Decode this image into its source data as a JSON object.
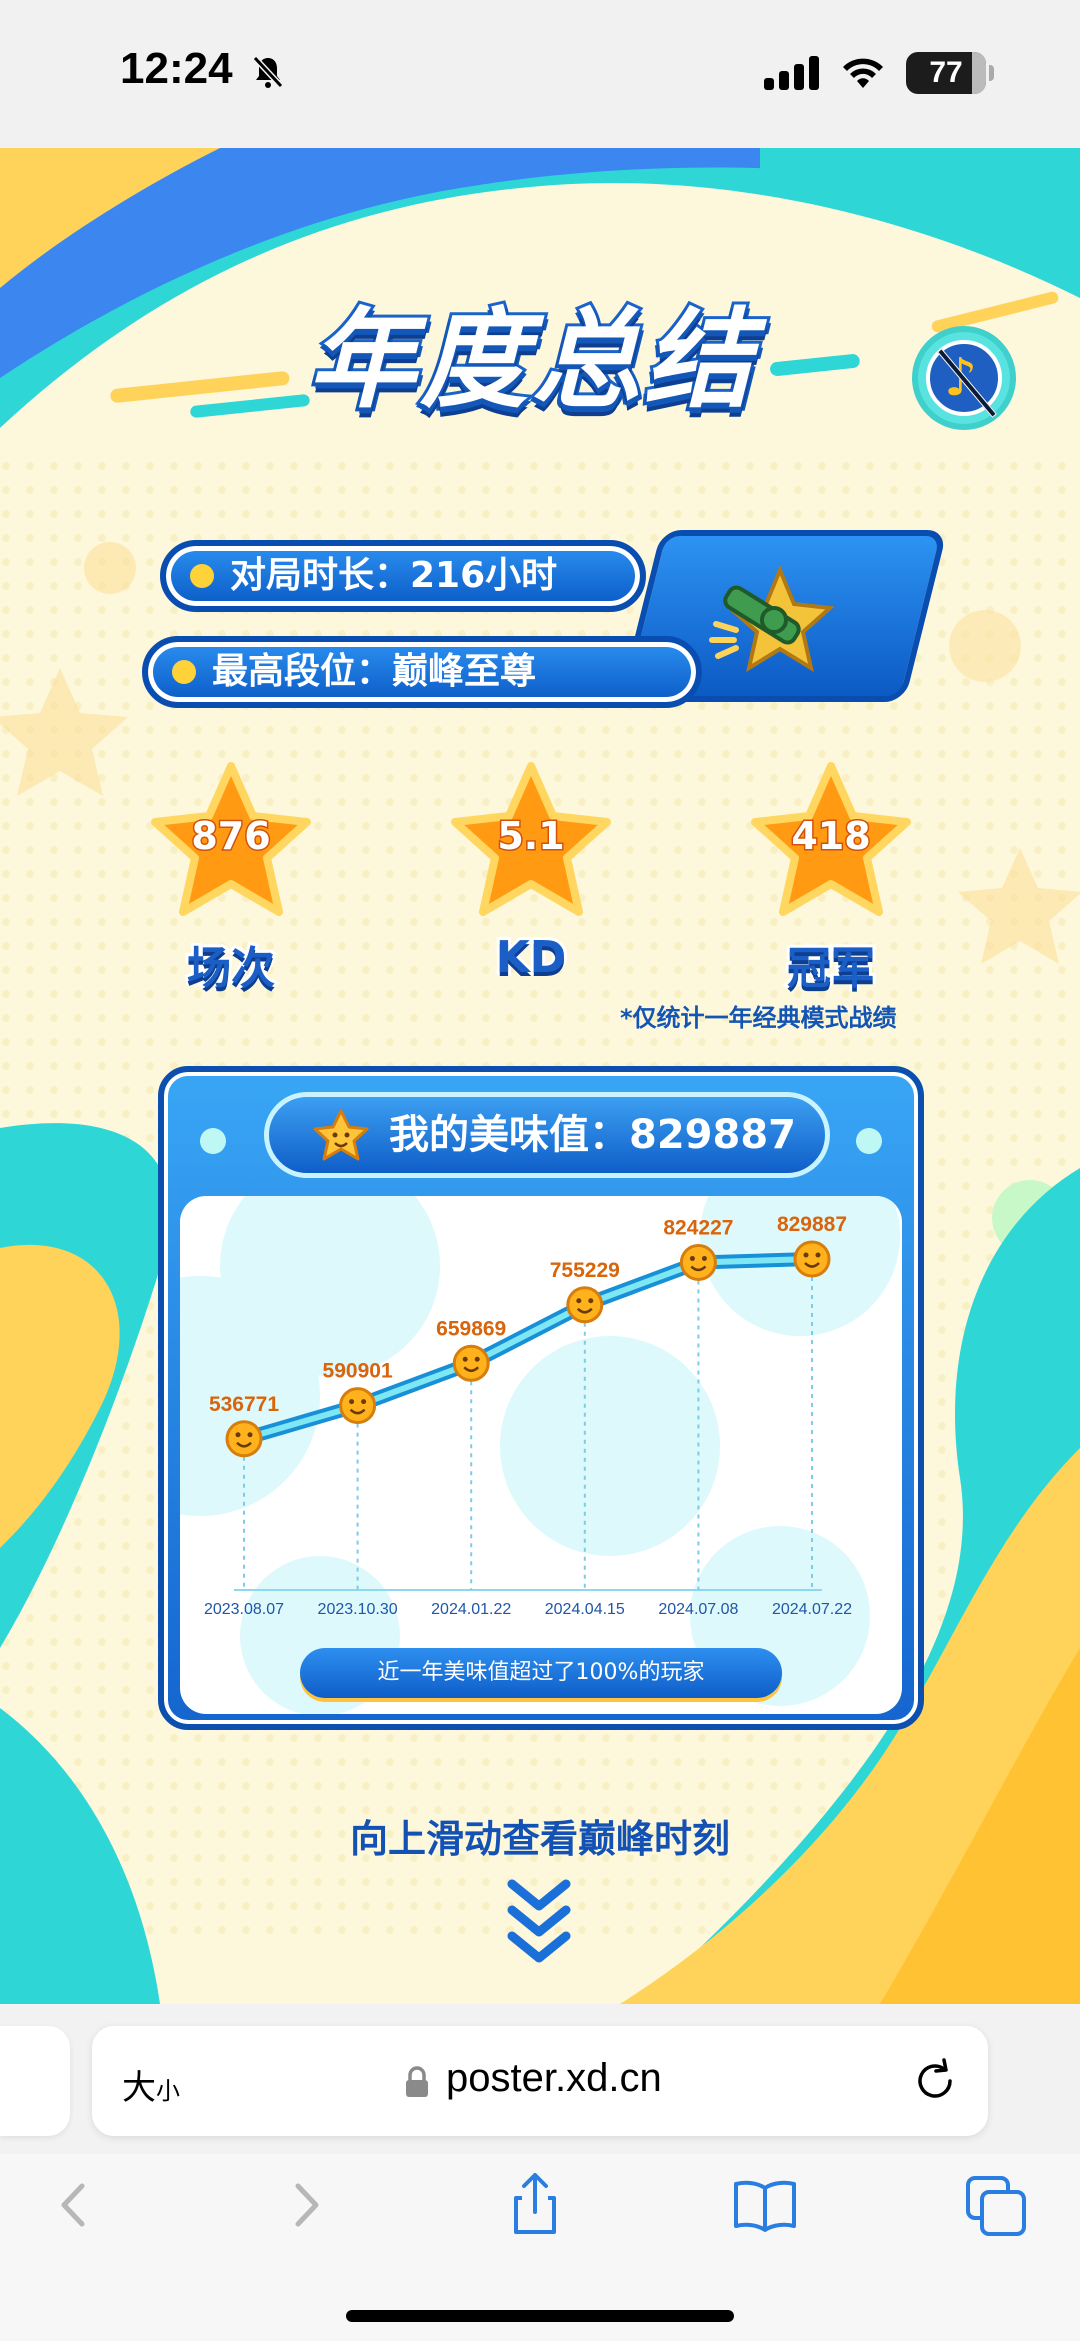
{
  "status_bar": {
    "time": "12:24",
    "battery": "77"
  },
  "poster": {
    "title": "年度总结",
    "stats": [
      {
        "label_value": "对局时长：216小时"
      },
      {
        "label_value": "最高段位：巅峰至尊"
      }
    ],
    "star_stats": [
      {
        "value": "876",
        "label": "场次"
      },
      {
        "value": "5.1",
        "label": "KD"
      },
      {
        "value": "418",
        "label": "冠军"
      }
    ],
    "footnote": "*仅统计一年经典模式战绩",
    "card": {
      "heading": "我的美味值：829887",
      "rank_text": "近一年美味值超过了100%的玩家"
    },
    "swipe_hint": "向上滑动查看巅峰时刻"
  },
  "chart_data": {
    "type": "line",
    "categories": [
      "2023.08.07",
      "2023.10.30",
      "2024.01.22",
      "2024.04.15",
      "2024.07.08",
      "2024.07.22"
    ],
    "values": [
      536771,
      590901,
      659869,
      755229,
      824227,
      829887
    ],
    "data_labels": [
      "536771",
      "590901",
      "659869",
      "755229",
      "824227",
      "829887"
    ],
    "title": "",
    "xlabel": "",
    "ylabel": "",
    "ylim": [
      300000,
      900000
    ],
    "grid": "vertical dashed drop lines",
    "colors": {
      "line": "#21a6e8",
      "marker": "#ffb21c",
      "label": "#d8640c"
    }
  },
  "browser": {
    "text_size_label": "大",
    "text_size_small": "小",
    "url": "poster.xd.cn"
  }
}
